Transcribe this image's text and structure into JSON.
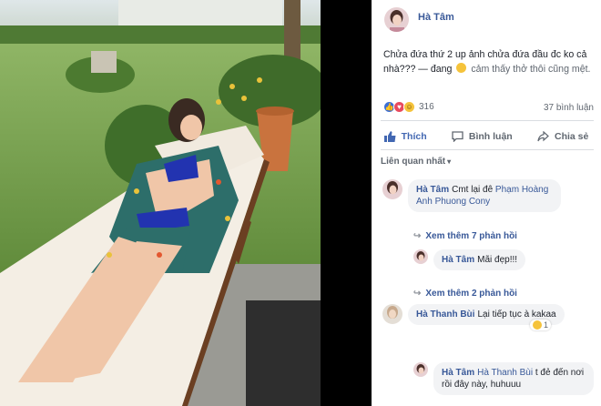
{
  "post": {
    "author": "Hà Tâm",
    "text": "Chửa đứa thứ 2 up ảnh chửa đứa đầu đc ko cả nhà??? — đang",
    "feeling": "cảm thấy thở thôi cũng mệt."
  },
  "reactions": {
    "count": "316",
    "comments": "37 bình luận",
    "icons": [
      "like-icon",
      "love-icon",
      "haha-icon"
    ],
    "colors": {
      "like": "#3b6fd6",
      "love": "#e84a5f",
      "haha": "#f5c33b"
    }
  },
  "actions": {
    "like": "Thích",
    "comment": "Bình luận",
    "share": "Chia sẻ"
  },
  "filter": {
    "label": "Liên quan nhất"
  },
  "comments": [
    {
      "author": "Hà Tâm",
      "prefix": "Cmt lại đê",
      "tag": "Phạm Hoàng Anh Phuong Cony"
    },
    {
      "more": "Xem thêm 7 phản hồi"
    },
    {
      "author": "Hà Tâm",
      "text": "Mãi đẹp!!!"
    },
    {
      "more": "Xem thêm 2 phản hồi"
    },
    {
      "author": "Hà Thanh Bùi",
      "text": "Lại tiếp tục à kakaa",
      "reaction_count": "1"
    },
    {
      "author": "Hà Tâm",
      "tag": "Hà Thanh Bùi",
      "text": "t đẻ đến nơi rồi đây này, huhuuu"
    }
  ],
  "theme": {
    "link": "#385898",
    "accent": "#4267b2",
    "muted": "#606770"
  }
}
